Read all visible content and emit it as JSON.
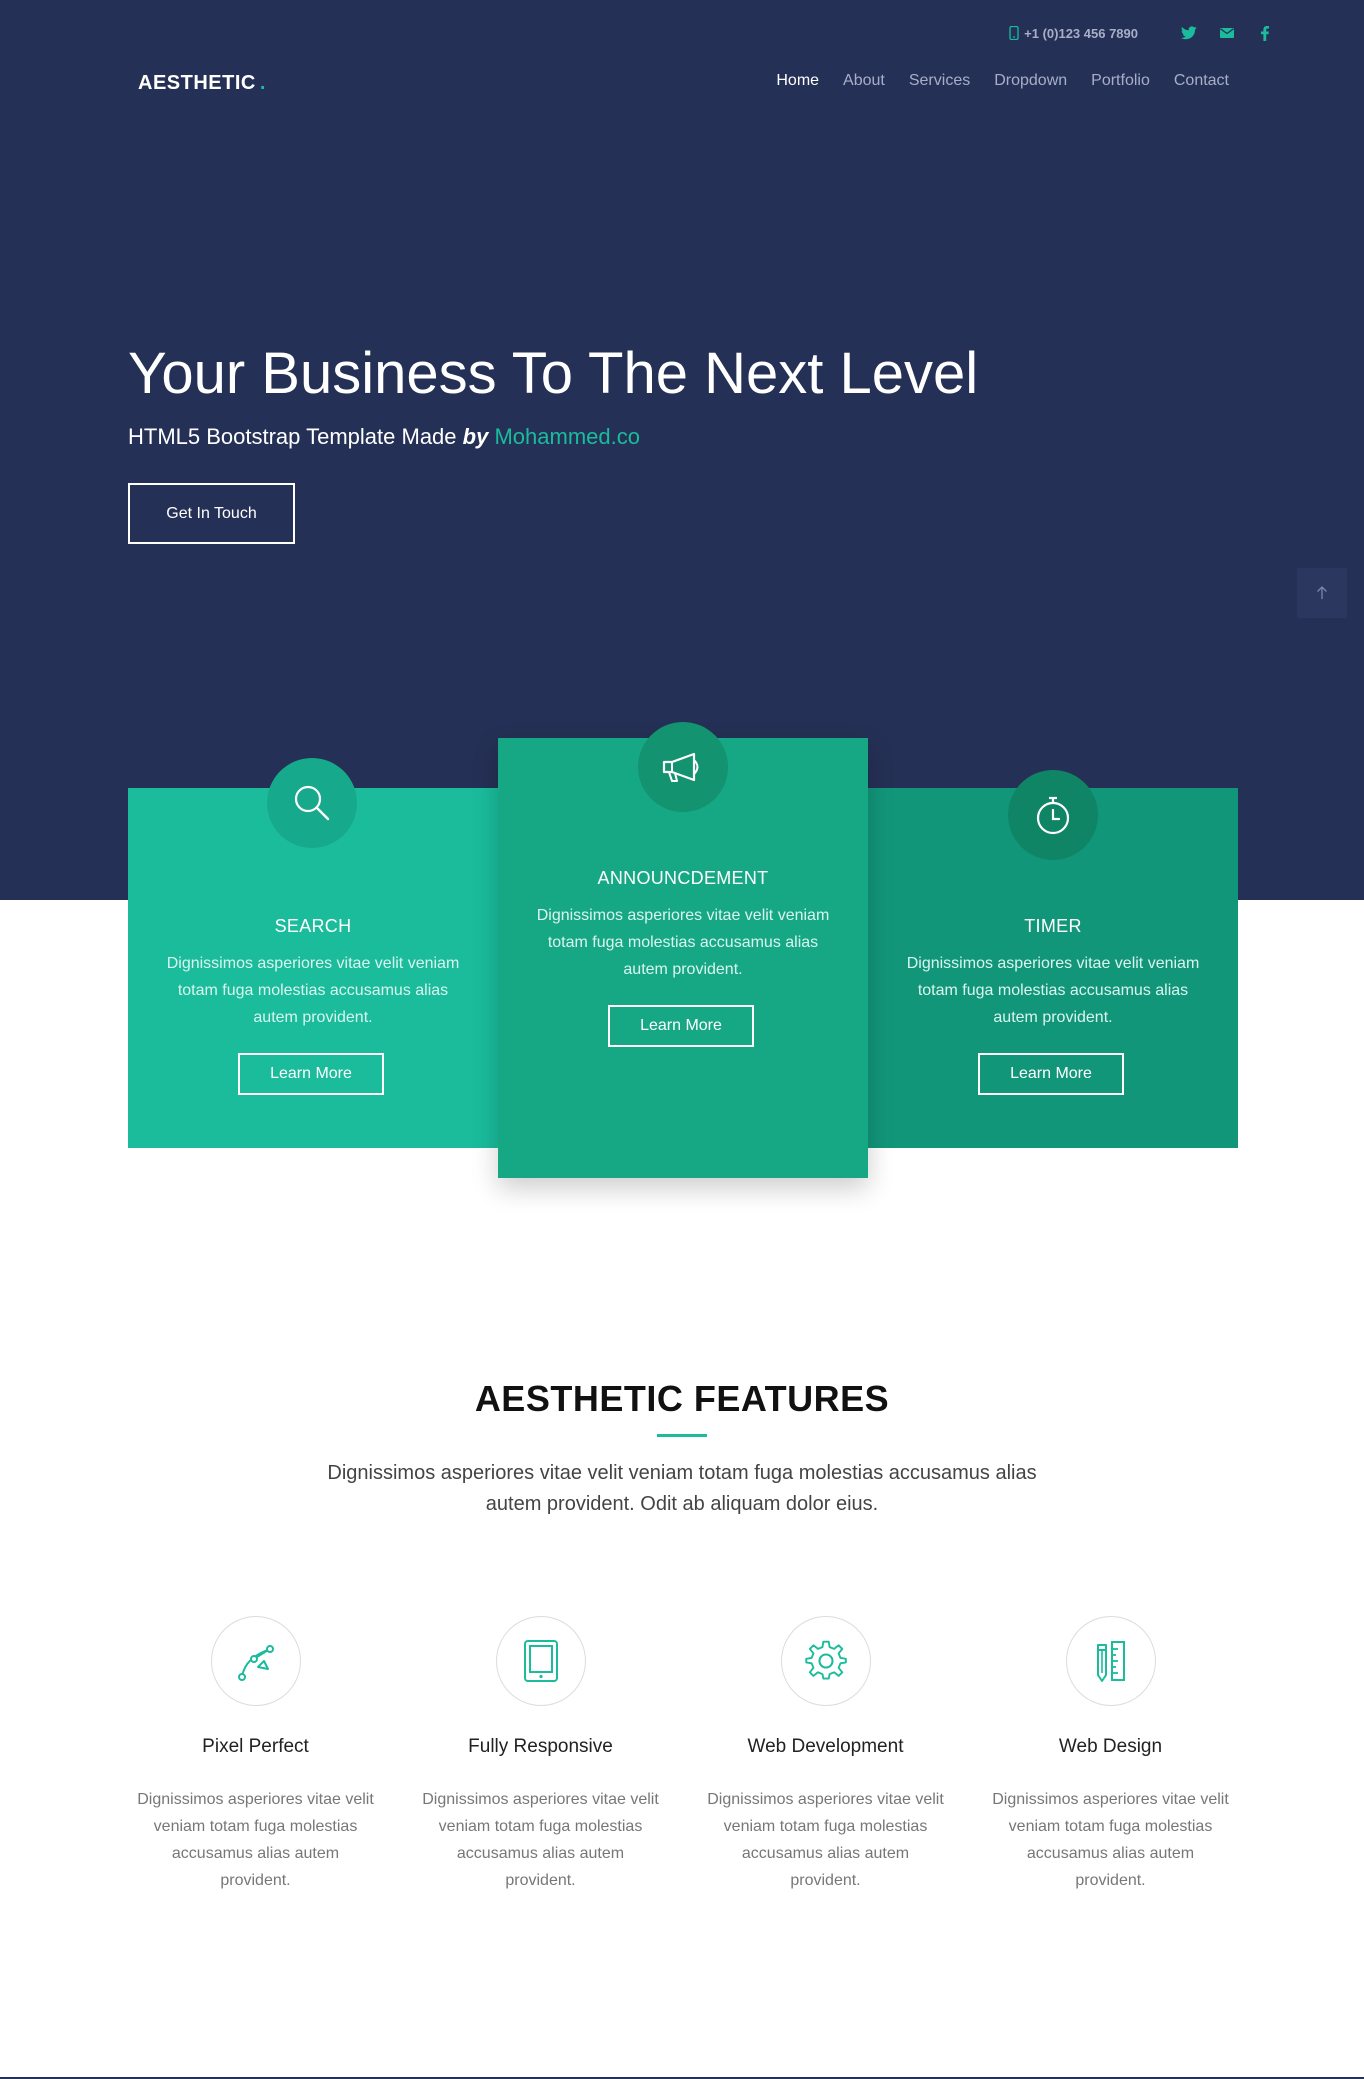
{
  "brand": {
    "name": "AESTHETIC",
    "dot": "."
  },
  "topbar": {
    "phone": "+1 (0)123 456 7890",
    "socials": [
      "twitter-icon",
      "mail-icon",
      "facebook-icon"
    ]
  },
  "nav": {
    "items": [
      "Home",
      "About",
      "Services",
      "Dropdown",
      "Portfolio",
      "Contact"
    ],
    "active": "Home"
  },
  "hero": {
    "title": "Your Business To The Next Level",
    "subtitle_prefix": "HTML5 Bootstrap Template Made",
    "subtitle_by": "by",
    "subtitle_author": "Mohammed.co",
    "cta": "Get In Touch"
  },
  "cards": [
    {
      "title": "SEARCH",
      "text": "Dignissimos asperiores vitae velit veniam totam fuga molestias accusamus alias autem provident.",
      "button": "Learn More",
      "icon": "search-icon"
    },
    {
      "title": "ANNOUNCDEMENT",
      "text": "Dignissimos asperiores vitae velit veniam totam fuga molestias accusamus alias autem provident.",
      "button": "Learn More",
      "icon": "megaphone-icon"
    },
    {
      "title": "TIMER",
      "text": "Dignissimos asperiores vitae velit veniam totam fuga molestias accusamus alias autem provident.",
      "button": "Learn More",
      "icon": "stopwatch-icon"
    }
  ],
  "features": {
    "title": "AESTHETIC FEATURES",
    "description": "Dignissimos asperiores vitae velit veniam totam fuga molestias accusamus alias autem provident. Odit ab aliquam dolor eius.",
    "items": [
      {
        "title": "Pixel Perfect",
        "text": "Dignissimos asperiores vitae velit veniam totam fuga molestias accusamus alias autem provident.",
        "icon": "vector-pen-icon"
      },
      {
        "title": "Fully Responsive",
        "text": "Dignissimos asperiores vitae velit veniam totam fuga molestias accusamus alias autem provident.",
        "icon": "tablet-icon"
      },
      {
        "title": "Web Development",
        "text": "Dignissimos asperiores vitae velit veniam totam fuga molestias accusamus alias autem provident.",
        "icon": "gear-icon"
      },
      {
        "title": "Web Design",
        "text": "Dignissimos asperiores vitae velit veniam totam fuga molestias accusamus alias autem provident.",
        "icon": "pencil-ruler-icon"
      }
    ]
  },
  "colors": {
    "hero_bg": "#253056",
    "accent": "#1abc9c",
    "card1": "#1abc9c",
    "card2": "#16a885",
    "card3": "#12967a"
  }
}
